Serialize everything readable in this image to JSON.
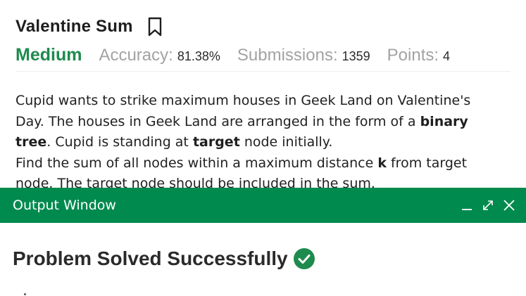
{
  "problem": {
    "title": "Valentine Sum",
    "difficulty": "Medium",
    "accuracy_label": "Accuracy:",
    "accuracy_value": "81.38%",
    "submissions_label": "Submissions:",
    "submissions_value": "1359",
    "points_label": "Points:",
    "points_value": "4",
    "description": {
      "p1_a": "Cupid wants to strike maximum houses in Geek Land on Valentine's Day. The houses in Geek Land are arranged in the form of a ",
      "p1_bold_a": "binary tree",
      "p1_b": ". Cupid is standing at ",
      "p1_bold_b": "target",
      "p1_c": " node initially.",
      "p2_a": "Find the sum of all nodes within a maximum distance ",
      "p2_bold": "k",
      "p2_b": " from target node. The target node should be included in the sum."
    }
  },
  "output_window": {
    "title": "Output Window",
    "result": "Problem Solved Successfully"
  },
  "icons": {
    "bookmark": "bookmark-icon",
    "minimize": "minimize-icon",
    "expand": "expand-icon",
    "close": "close-icon",
    "success": "check-circle-icon"
  },
  "colors": {
    "accent": "#008a4e",
    "difficulty": "#1e8b4e",
    "muted": "#a3a3a3"
  }
}
